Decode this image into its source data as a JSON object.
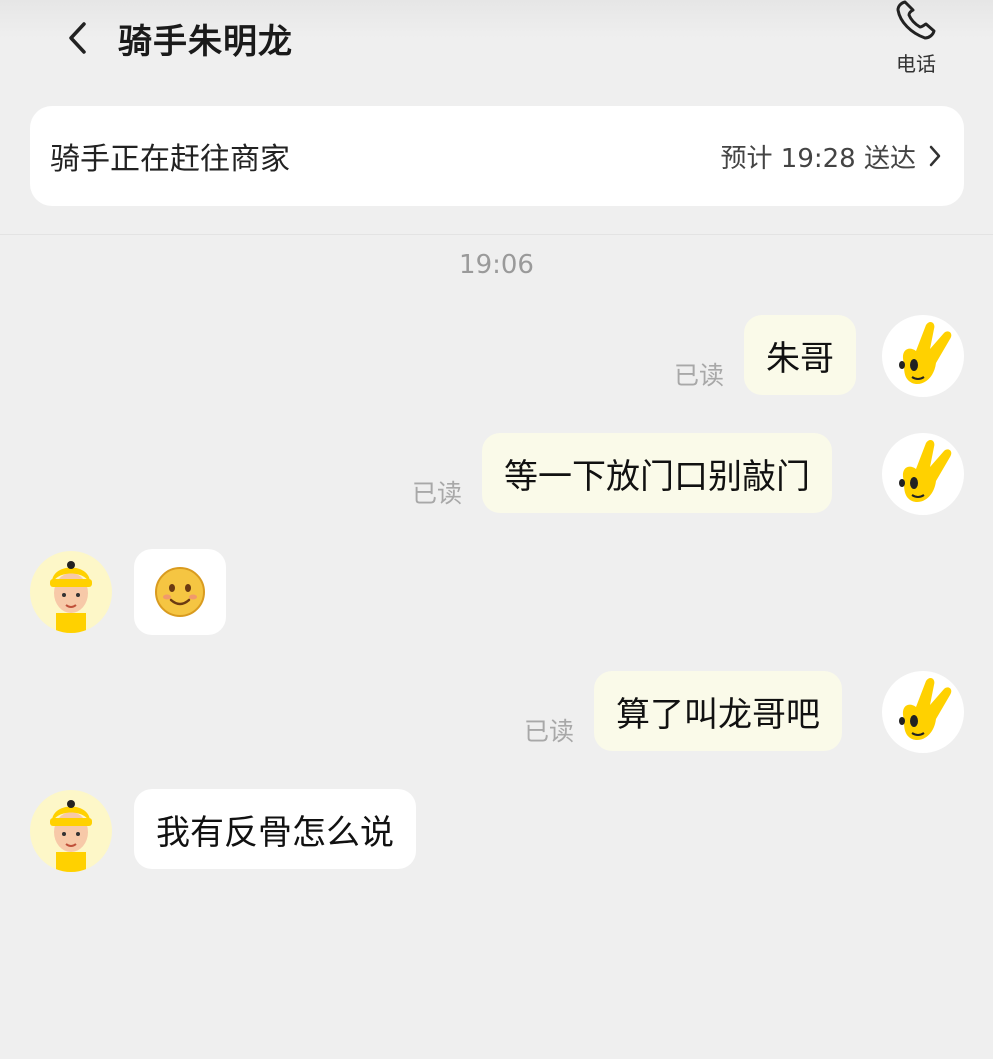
{
  "header": {
    "title": "骑手朱明龙",
    "call_label": "电话"
  },
  "status_card": {
    "status": "骑手正在赶往商家",
    "eta": "预计 19:28 送达"
  },
  "chat": {
    "timestamp": "19:06",
    "read_label": "已读",
    "messages": [
      {
        "from": "me",
        "text": "朱哥",
        "status": "已读"
      },
      {
        "from": "me",
        "text": "等一下放门口别敲门",
        "status": "已读"
      },
      {
        "from": "rider",
        "type": "emoji",
        "emoji": "smile-emoji"
      },
      {
        "from": "me",
        "text": "算了叫龙哥吧",
        "status": "已读"
      },
      {
        "from": "rider",
        "text": "我有反骨怎么说"
      }
    ]
  },
  "colors": {
    "background": "#efefef",
    "outgoing_bubble": "#fafae9",
    "incoming_bubble": "#ffffff",
    "brand_yellow": "#ffd100"
  }
}
